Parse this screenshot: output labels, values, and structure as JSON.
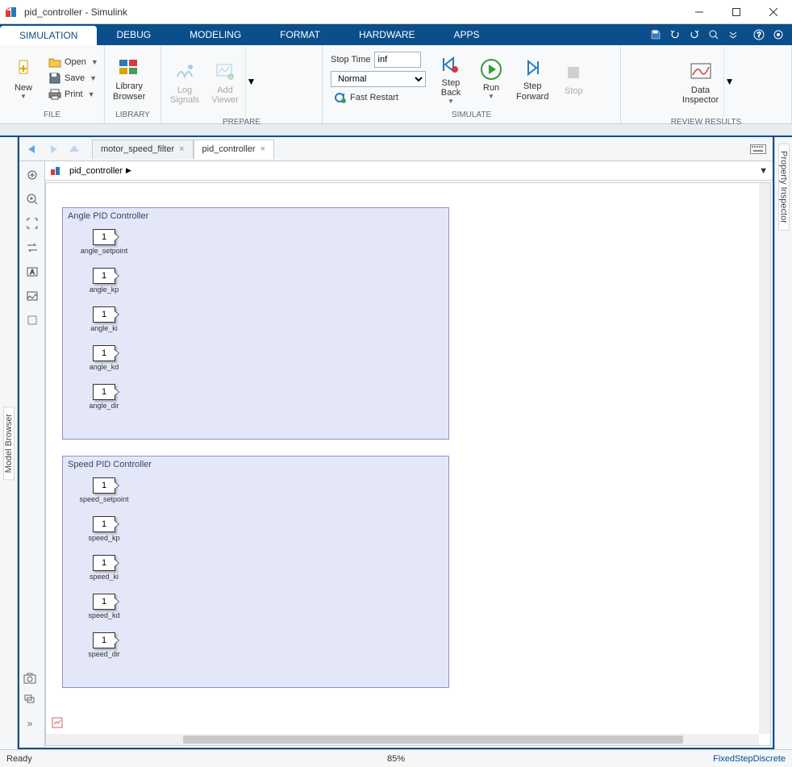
{
  "window": {
    "title": "pid_controller - Simulink"
  },
  "ribbon_tabs": [
    "SIMULATION",
    "DEBUG",
    "MODELING",
    "FORMAT",
    "HARDWARE",
    "APPS"
  ],
  "file_group": {
    "new": "New",
    "open": "Open",
    "save": "Save",
    "print": "Print",
    "label": "FILE"
  },
  "library_group": {
    "library": "Library\nBrowser",
    "label": "LIBRARY"
  },
  "prepare_group": {
    "log": "Log\nSignals",
    "viewer": "Add\nViewer",
    "label": "PREPARE"
  },
  "simulate_group": {
    "stop_time_label": "Stop Time",
    "stop_time_value": "inf",
    "mode": "Normal",
    "fast_restart": "Fast Restart",
    "step_back": "Step\nBack",
    "run": "Run",
    "step_forward": "Step\nForward",
    "stop": "Stop",
    "label": "SIMULATE"
  },
  "review_group": {
    "data_inspector": "Data\nInspector",
    "label": "REVIEW RESULTS"
  },
  "side_left": "Model Browser",
  "side_right": "Property Inspector",
  "file_tabs": [
    {
      "name": "motor_speed_filter",
      "active": false
    },
    {
      "name": "pid_controller",
      "active": true
    }
  ],
  "breadcrumb": "pid_controller",
  "areas": [
    {
      "title": "Angle PID Controller",
      "ports": [
        {
          "num": "1",
          "label": "angle_setpoint"
        },
        {
          "num": "1",
          "label": "angle_kp"
        },
        {
          "num": "1",
          "label": "angle_ki"
        },
        {
          "num": "1",
          "label": "angle_kd"
        },
        {
          "num": "1",
          "label": "angle_dir"
        }
      ]
    },
    {
      "title": "Speed PID Controller",
      "ports": [
        {
          "num": "1",
          "label": "speed_setpoint"
        },
        {
          "num": "1",
          "label": "speed_kp"
        },
        {
          "num": "1",
          "label": "speed_ki"
        },
        {
          "num": "1",
          "label": "speed_kd"
        },
        {
          "num": "1",
          "label": "speed_dir"
        }
      ]
    }
  ],
  "status": {
    "left": "Ready",
    "zoom": "85%",
    "solver": "FixedStepDiscrete"
  }
}
